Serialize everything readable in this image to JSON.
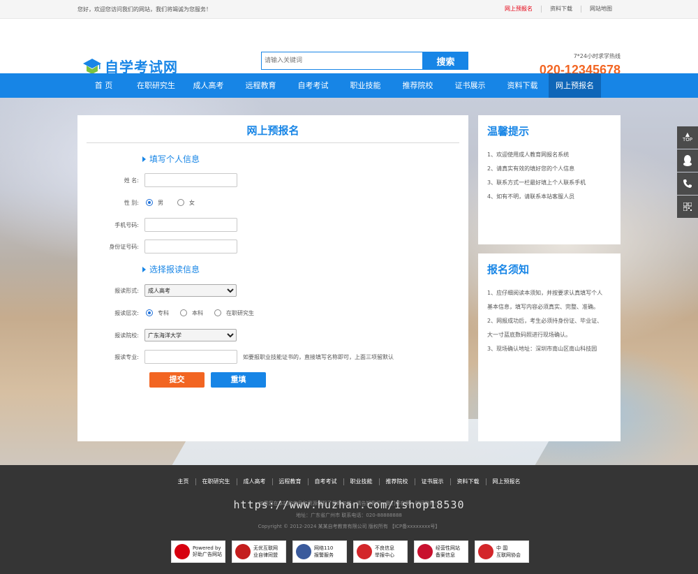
{
  "topbar": {
    "welcome": "您好，欢迎您访问我们的网站，我们将竭诚为您服务！",
    "links": [
      "网上预报名",
      "资料下载",
      "网站地图"
    ]
  },
  "header": {
    "logo_text": "自学考试网",
    "search_placeholder": "请输入关键词",
    "search_button": "搜索",
    "hotline_label": "7*24小时求学热线",
    "hotline_number": "020-12345678"
  },
  "nav": {
    "items": [
      "首 页",
      "在职研究生",
      "成人高考",
      "远程教育",
      "自考考试",
      "职业技能",
      "推荐院校",
      "证书展示",
      "资料下载",
      "网上预报名"
    ],
    "active_index": 9
  },
  "form": {
    "title": "网上预报名",
    "section1": "填写个人信息",
    "name_label": "姓  名:",
    "gender_label": "性  别:",
    "gender_options": [
      "男",
      "女"
    ],
    "phone_label": "手机号码:",
    "id_label": "身份证号码:",
    "section2": "选择报读信息",
    "mode_label": "报读形式:",
    "mode_value": "成人高考",
    "level_label": "报读层次:",
    "level_options": [
      "专科",
      "本科",
      "在职研究生"
    ],
    "school_label": "报读院校:",
    "school_value": "广东海洋大学",
    "major_label": "报读专业:",
    "major_hint": "如要报职业技能证书的，直接填写名称即可，上面三项留默认",
    "submit": "提交",
    "reset": "重填"
  },
  "tips": {
    "title": "温馨提示",
    "items": [
      "1、欢迎使用成人教育网报名系统",
      "2、请真实有效的填好您的个人信息",
      "3、联系方式一栏最好填上个人联系手机",
      "4、如有不明，请联系本站客服人员"
    ]
  },
  "notice": {
    "title": "报名须知",
    "items": [
      "1、应仔细阅读本须知，并按要求认真填写个人",
      "基本信息，填写内容必须真实、完整、准确。",
      "2、网报成功后，考生必须持身份证、毕业证、",
      "大一寸蓝底数码照进行现场确认。",
      "3、现场确认地址：深圳市南山区南山科技园"
    ]
  },
  "floatbar": {
    "top_label": "TOP"
  },
  "footer": {
    "nav": [
      "主页",
      "在职研究生",
      "成人高考",
      "远程教育",
      "自考考试",
      "职业技能",
      "推荐院校",
      "证书展示",
      "资料下载",
      "网上预报名"
    ],
    "disclaimer": "如果您在本站的信息和资源侵犯了您的权益，请告知我们，我们将在第一时间删除！",
    "watermark": "https://www.huzhan.com/ishop18530",
    "address": "地址：广东省广州市   联系电话：020-88888888",
    "copyright": "Copyright © 2012-2024 某某自考教育有限公司 版权所有 【ICP备xxxxxxxx号】",
    "badges": [
      {
        "line1": "Powered by",
        "line2": "好助广告网站",
        "color": "#d7000f"
      },
      {
        "line1": "无优互联网",
        "line2": "业自律同盟",
        "color": "#c41e1e"
      },
      {
        "line1": "网络110",
        "line2": "报警服务",
        "color": "#3a5a9c"
      },
      {
        "line1": "不良信息",
        "line2": "举报中心",
        "color": "#d3262a"
      },
      {
        "line1": "经营性网站",
        "line2": "备案信息",
        "color": "#c8102e"
      },
      {
        "line1": "中 国",
        "line2": "互联网协会",
        "color": "#d3262a"
      }
    ]
  }
}
